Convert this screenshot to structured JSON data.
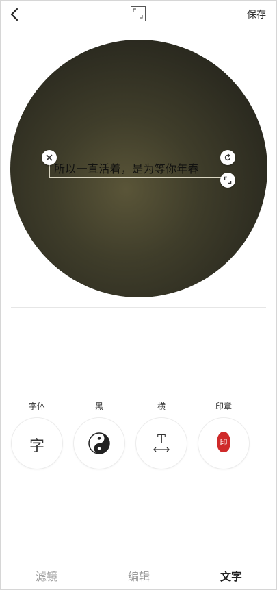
{
  "header": {
    "back_icon": "chevron-left-icon",
    "crop_icon": "crop-frame-icon",
    "save_label": "保存"
  },
  "canvas": {
    "overlay_text": "所以一直活着，是为等你年春",
    "handles": {
      "close_icon": "close-icon",
      "rotate_icon": "rotate-icon",
      "scale_icon": "resize-icon"
    },
    "colors": {
      "background_center": "#5a5538",
      "background_edge": "#1f1e17",
      "text": "#121210"
    }
  },
  "tools": [
    {
      "label": "字体",
      "icon": "font-icon",
      "glyph": "字"
    },
    {
      "label": "黑",
      "icon": "yin-yang-icon"
    },
    {
      "label": "横",
      "icon": "text-horizontal-icon",
      "glyph": "T"
    },
    {
      "label": "印章",
      "icon": "seal-stamp-icon",
      "glyph": "印",
      "color": "#cf2a2a"
    }
  ],
  "tabs": [
    {
      "label": "滤镜",
      "active": false
    },
    {
      "label": "编辑",
      "active": false
    },
    {
      "label": "文字",
      "active": true
    }
  ]
}
